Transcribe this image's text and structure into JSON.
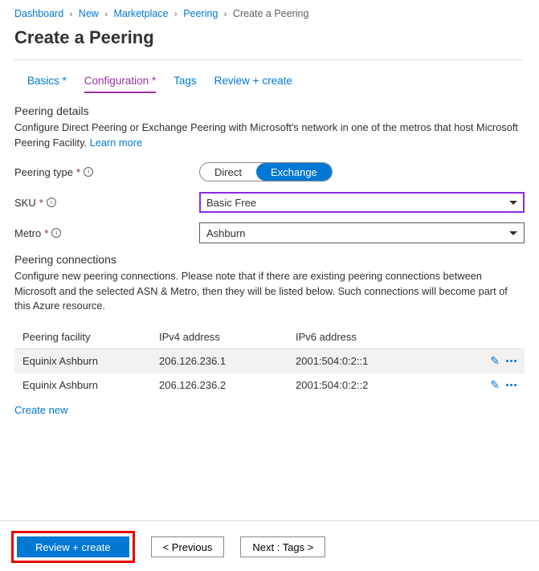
{
  "breadcrumb": {
    "items": [
      "Dashboard",
      "New",
      "Marketplace",
      "Peering"
    ],
    "current": "Create a Peering"
  },
  "page_title": "Create a Peering",
  "tabs": {
    "basics": "Basics",
    "config": "Configuration",
    "tags": "Tags",
    "review": "Review + create"
  },
  "details": {
    "title": "Peering details",
    "desc": "Configure Direct Peering or Exchange Peering with Microsoft's network in one of the metros that host Microsoft Peering Facility. ",
    "learn_more": "Learn more"
  },
  "form": {
    "peering_type_label": "Peering type",
    "peering_type_options": {
      "direct": "Direct",
      "exchange": "Exchange"
    },
    "sku_label": "SKU",
    "sku_value": "Basic Free",
    "metro_label": "Metro",
    "metro_value": "Ashburn"
  },
  "connections": {
    "title": "Peering connections",
    "desc": "Configure new peering connections. Please note that if there are existing peering connections between Microsoft and the selected ASN & Metro, then they will be listed below. Such connections will become part of this Azure resource.",
    "headers": {
      "facility": "Peering facility",
      "ipv4": "IPv4 address",
      "ipv6": "IPv6 address"
    },
    "rows": [
      {
        "facility": "Equinix Ashburn",
        "ipv4": "206.126.236.1",
        "ipv6": "2001:504:0:2::1"
      },
      {
        "facility": "Equinix Ashburn",
        "ipv4": "206.126.236.2",
        "ipv6": "2001:504:0:2::2"
      }
    ],
    "create_new": "Create new"
  },
  "footer": {
    "review": "Review + create",
    "previous": "< Previous",
    "next": "Next : Tags >"
  }
}
